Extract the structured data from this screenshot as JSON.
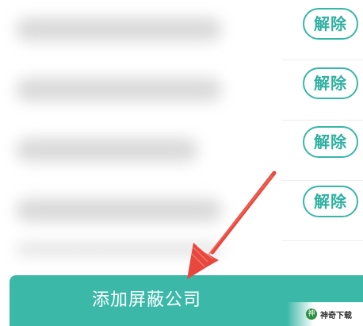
{
  "list": {
    "rows": [
      {
        "action_label": "解除"
      },
      {
        "action_label": "解除"
      },
      {
        "action_label": "解除"
      },
      {
        "action_label": "解除"
      }
    ]
  },
  "footer": {
    "add_label": "添加屏蔽公司"
  },
  "watermark": {
    "logo_char": "神",
    "text": "神奇下载"
  },
  "colors": {
    "accent": "#3cb8a9",
    "button_border": "#37b7a7",
    "arrow": "#e8473d"
  },
  "icons": {
    "arrow": "annotation-arrow-icon"
  }
}
